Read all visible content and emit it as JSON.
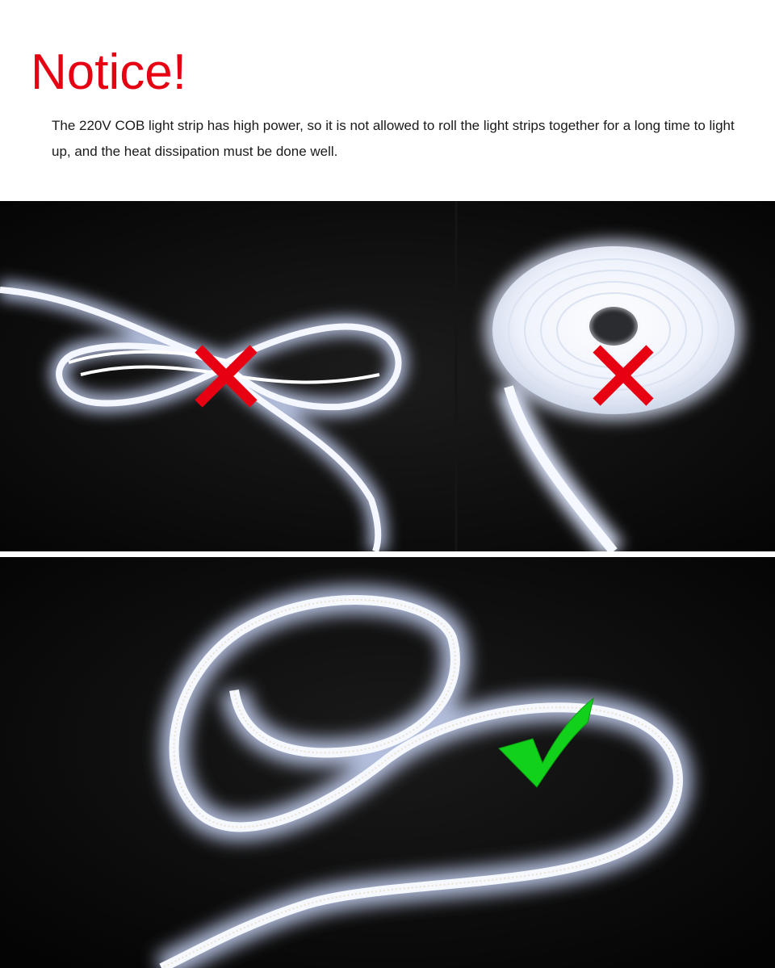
{
  "header": {
    "title": "Notice!",
    "description": "The 220V COB light strip has high power, so it is not allowed to roll the light strips together for a long time to light up, and the heat dissipation must be done well."
  },
  "images": {
    "top": {
      "left": {
        "subject": "looped-light-strip",
        "mark": "wrong-mark-icon"
      },
      "right": {
        "subject": "coiled-light-strip",
        "mark": "wrong-mark-icon"
      }
    },
    "bottom": {
      "subject": "unrolled-light-strip",
      "mark": "correct-mark-icon"
    }
  },
  "colors": {
    "title": "#e60012",
    "wrong_mark": "#e60012",
    "correct_mark": "#11d11a",
    "background": "#0a0a0a",
    "strip_glow": "#e8f0ff"
  }
}
